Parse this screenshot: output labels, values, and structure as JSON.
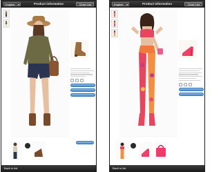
{
  "screens": [
    {
      "language": "English",
      "title": "Product information",
      "close_label": "Close List",
      "back_label": "Back to list",
      "colors": {
        "pill": "#4b8cc8",
        "toolbar": "#1d1d1d"
      }
    },
    {
      "language": "English",
      "title": "Product information",
      "close_label": "Close List",
      "back_label": "Back to list",
      "colors": {
        "pill": "#4b8cc8",
        "toolbar": "#1d1d1d"
      }
    }
  ],
  "icons": [
    "chevron-down-icon",
    "model-photo",
    "boot-photo",
    "sandal-photo",
    "handbag-photo",
    "close-icon"
  ]
}
